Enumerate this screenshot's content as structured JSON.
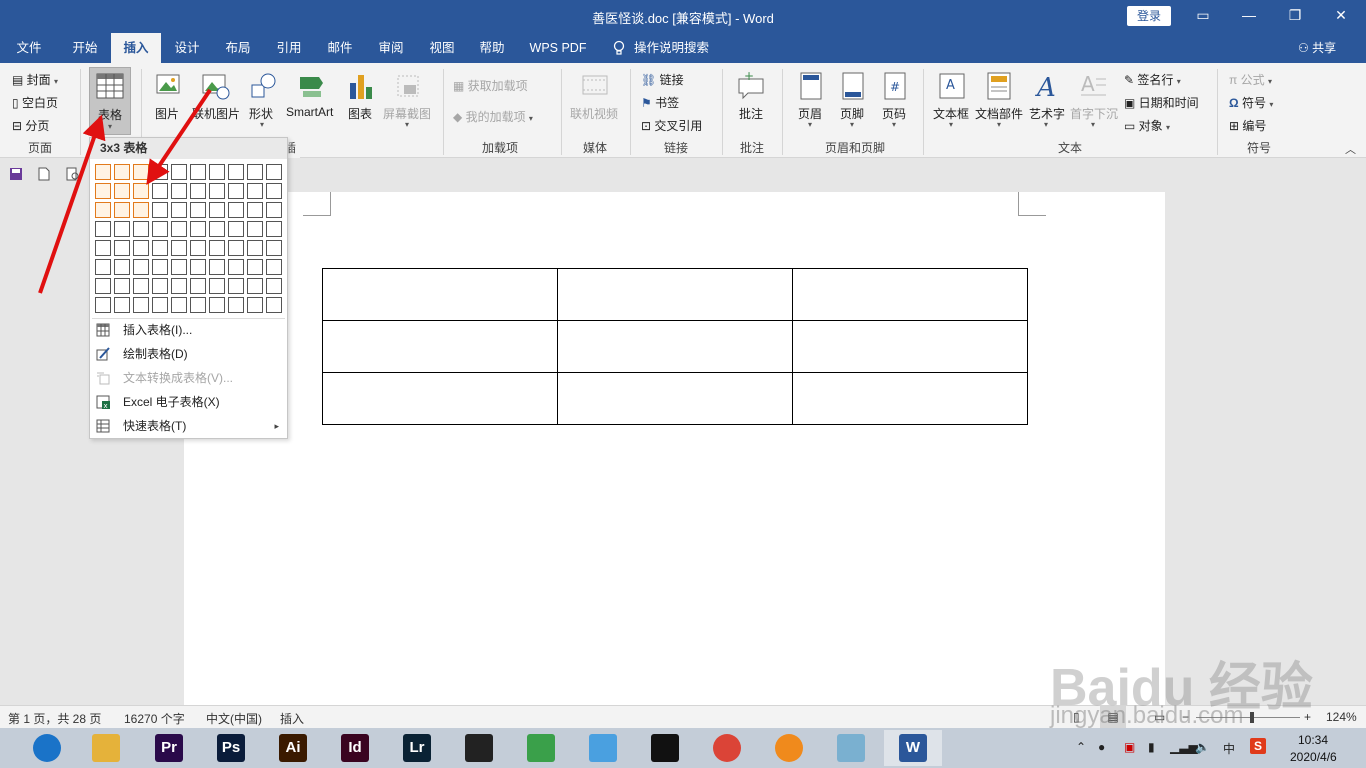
{
  "window": {
    "title": "善医怪谈.doc [兼容模式]  -  Word",
    "login": "登录",
    "restore_icon": "ribbon-display-icon",
    "minimize": "—",
    "maximize": "❐",
    "close": "✕"
  },
  "tabs": [
    "文件",
    "开始",
    "插入",
    "设计",
    "布局",
    "引用",
    "邮件",
    "审阅",
    "视图",
    "帮助",
    "WPS PDF"
  ],
  "active_tab": "插入",
  "search_hint": "操作说明搜索",
  "share": "共享",
  "ribbon": {
    "pages_group": {
      "cover": "封面",
      "blank": "空白页",
      "break": "分页",
      "label": "页面"
    },
    "table_group": {
      "table": "表格"
    },
    "illustrations_group": {
      "picture": "图片",
      "online_picture": "联机图片",
      "shapes": "形状",
      "smartart": "SmartArt",
      "chart": "图表",
      "screenshot": "屏幕截图",
      "label": "插图"
    },
    "addins_group": {
      "get_addins": "获取加载项",
      "my_addins": "我的加载项",
      "label": "加载项"
    },
    "media_group": {
      "online_video": "联机视频",
      "label": "媒体"
    },
    "links_group": {
      "link": "链接",
      "bookmark": "书签",
      "cross_ref": "交叉引用",
      "label": "链接"
    },
    "comments_group": {
      "comment": "批注",
      "label": "批注"
    },
    "header_footer_group": {
      "header": "页眉",
      "footer": "页脚",
      "page_number": "页码",
      "label": "页眉和页脚"
    },
    "text_group": {
      "text_box": "文本框",
      "doc_parts": "文档部件",
      "wordart": "艺术字",
      "drop_cap": "首字下沉",
      "signature": "签名行",
      "datetime": "日期和时间",
      "object": "对象",
      "label": "文本"
    },
    "symbols_group": {
      "equation": "公式",
      "symbol": "符号",
      "number": "编号",
      "label": "符号"
    }
  },
  "table_dropdown": {
    "grid_title": "3x3 表格",
    "grid_cols": 10,
    "grid_rows": 8,
    "selected_cols": 3,
    "selected_rows": 3,
    "items": [
      {
        "label": "插入表格(I)...",
        "enabled": true,
        "icon": "table-icon"
      },
      {
        "label": "绘制表格(D)",
        "enabled": true,
        "icon": "draw-table-icon"
      },
      {
        "label": "文本转换成表格(V)...",
        "enabled": false,
        "icon": "text-to-table-icon"
      },
      {
        "label": "Excel 电子表格(X)",
        "enabled": true,
        "icon": "excel-icon"
      },
      {
        "label": "快速表格(T)",
        "enabled": true,
        "icon": "quick-table-icon",
        "submenu": true
      }
    ]
  },
  "document": {
    "table_rows": 3,
    "table_cols": 3
  },
  "status": {
    "page": "第 1 页，共 28 页",
    "words": "16270 个字",
    "language": "中文(中国)",
    "mode": "插入",
    "zoom": "124%"
  },
  "taskbar": {
    "apps": [
      {
        "name": "browser",
        "label": "",
        "color": "#1a73c8"
      },
      {
        "name": "explorer",
        "label": "",
        "color": "#e5b23a"
      },
      {
        "name": "premiere",
        "label": "Pr",
        "color": "#2a0a4a"
      },
      {
        "name": "photoshop",
        "label": "Ps",
        "color": "#0a1c3a"
      },
      {
        "name": "illustrator",
        "label": "Ai",
        "color": "#3a1a00"
      },
      {
        "name": "indesign",
        "label": "Id",
        "color": "#3a0420"
      },
      {
        "name": "lightroom",
        "label": "Lr",
        "color": "#0a2234"
      },
      {
        "name": "video-editor",
        "label": "",
        "color": "#222222"
      },
      {
        "name": "app-9",
        "label": "",
        "color": "#3aa04a"
      },
      {
        "name": "app-10",
        "label": "",
        "color": "#4aa0e0"
      },
      {
        "name": "qq",
        "label": "",
        "color": "#111111"
      },
      {
        "name": "chrome",
        "label": "",
        "color": "#db4437"
      },
      {
        "name": "app-13",
        "label": "",
        "color": "#f08a1c"
      },
      {
        "name": "app-14",
        "label": "",
        "color": "#7ab0d0"
      },
      {
        "name": "word",
        "label": "W",
        "color": "#2b579a"
      }
    ],
    "ime": "中",
    "time": "10:34",
    "date": "2020/4/6"
  },
  "watermark": {
    "brand": "Baidu 经验",
    "url": "jingyan.baidu.com"
  }
}
